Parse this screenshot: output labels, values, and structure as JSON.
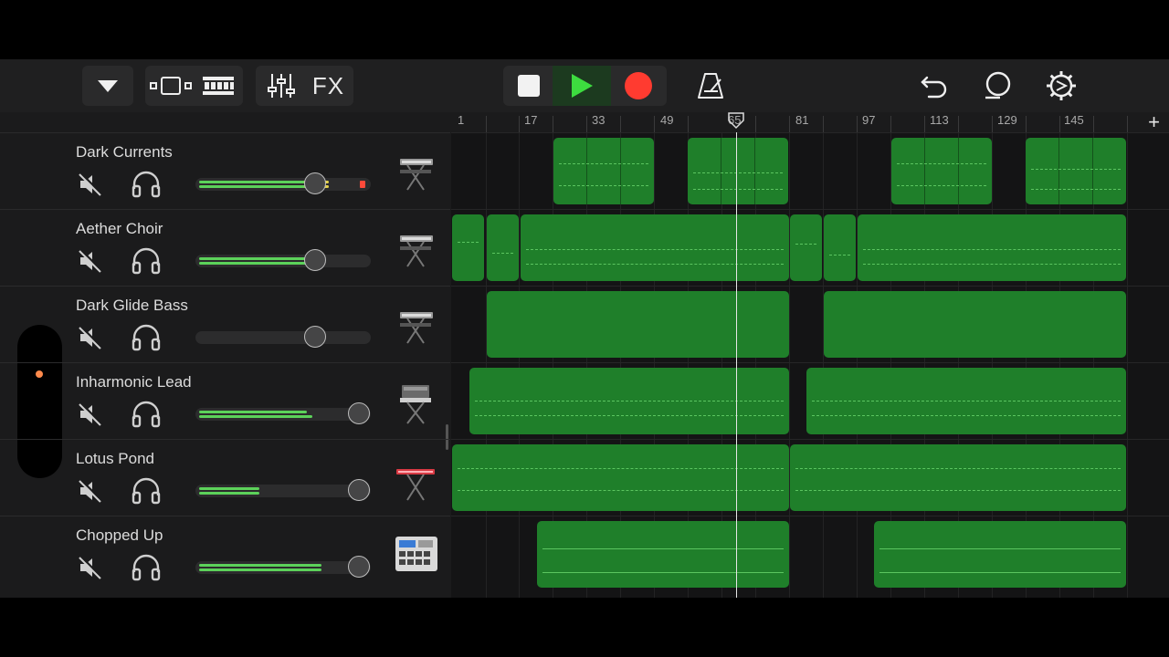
{
  "toolbar": {
    "fx_label": "FX",
    "buttons": [
      "browser-dropdown",
      "tracks-view",
      "live-loops-view",
      "mixer",
      "fx",
      "stop",
      "play",
      "record",
      "metronome",
      "undo",
      "loop-browser",
      "settings"
    ]
  },
  "colors": {
    "region": "#1f7f2a",
    "play": "#3ddc3f",
    "record": "#ff3b30",
    "meter": "#5cd25a"
  },
  "ruler": {
    "bars": [
      "1",
      "17",
      "33",
      "49",
      "65",
      "81",
      "97",
      "113",
      "129",
      "145"
    ],
    "add_label": "+"
  },
  "tracks": [
    {
      "name": "Dark Currents",
      "volume": 0.66,
      "meter": 0.66,
      "instrument": "keyboard-stand-icon"
    },
    {
      "name": "Aether Choir",
      "volume": 0.66,
      "meter": 0.6,
      "instrument": "keyboard-stand-icon"
    },
    {
      "name": "Dark Glide Bass",
      "volume": 0.66,
      "meter": 0.0,
      "instrument": "keyboard-stand-icon"
    },
    {
      "name": "Inharmonic Lead",
      "volume": 0.9,
      "meter": 0.6,
      "instrument": "synth-stand-icon"
    },
    {
      "name": "Lotus Pond",
      "volume": 0.9,
      "meter": 0.36,
      "instrument": "red-keyboard-icon"
    },
    {
      "name": "Chopped Up",
      "volume": 0.9,
      "meter": 0.7,
      "instrument": "drum-machine-icon"
    }
  ],
  "playhead_bar": 65
}
